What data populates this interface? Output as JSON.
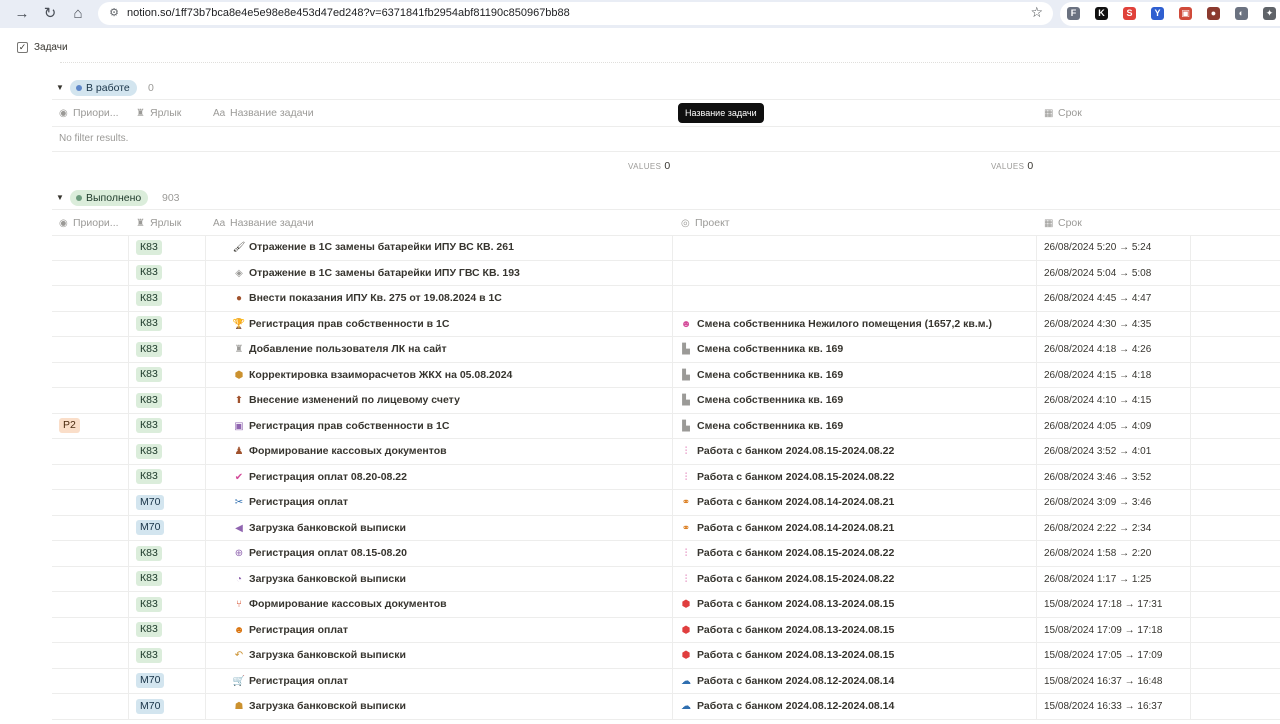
{
  "browser": {
    "url": "notion.so/1ff73b7bca8e4e5e98e8e453d47ed248?v=6371841fb2954abf81190c850967bb88",
    "extensions": [
      {
        "label": "F",
        "color": "#6b7280"
      },
      {
        "label": "K",
        "color": "#111111"
      },
      {
        "label": "S",
        "color": "#e0413a"
      },
      {
        "label": "Y",
        "color": "#2f5fd0"
      },
      {
        "label": "▣",
        "color": "#d04a3a"
      },
      {
        "label": "●",
        "color": "#8b3a2f"
      },
      {
        "label": "◐",
        "color": "#6b7280"
      },
      {
        "label": "✦",
        "color": "#5f6368"
      }
    ]
  },
  "database": {
    "title": "Задачи"
  },
  "groups": {
    "in_progress": {
      "label": "В работе",
      "count": "0",
      "no_results": "No filter results.",
      "calc_label": "VALUES",
      "calc_value": "0"
    },
    "done": {
      "label": "Выполнено",
      "count": "903"
    }
  },
  "columns": {
    "priority": "Приори...",
    "tag": "Ярлык",
    "name": "Название задачи",
    "project": "Проект",
    "date": "Срок"
  },
  "tooltip": "Название задачи",
  "rows": [
    {
      "priority": "",
      "tag": "К83",
      "tag_color": "green",
      "icon": "🖌",
      "icon_color": "#37352f",
      "name": "Отражение в 1С замены батарейки ИПУ ВС КВ. 261",
      "project_icon": "",
      "project_icon_color": "",
      "project": "",
      "date": "26/08/2024 5:20 → 5:24"
    },
    {
      "priority": "",
      "tag": "К83",
      "tag_color": "green",
      "icon": "◈",
      "icon_color": "#9b9a97",
      "name": "Отражение в 1С замены батарейки ИПУ ГВС КВ. 193",
      "project_icon": "",
      "project_icon_color": "",
      "project": "",
      "date": "26/08/2024 5:04 → 5:08"
    },
    {
      "priority": "",
      "tag": "К83",
      "tag_color": "green",
      "icon": "●",
      "icon_color": "#a0522d",
      "name": "Внести показания ИПУ Кв. 275 от 19.08.2024 в 1С",
      "project_icon": "",
      "project_icon_color": "",
      "project": "",
      "date": "26/08/2024 4:45 → 4:47"
    },
    {
      "priority": "",
      "tag": "К83",
      "tag_color": "green",
      "icon": "🏆",
      "icon_color": "#cb912f",
      "name": "Регистрация прав собственности в 1С",
      "project_icon": "☻",
      "project_icon_color": "#d44c9a",
      "project": "Смена собственника Нежилого помещения (1657,2 кв.м.)",
      "date": "26/08/2024 4:30 → 4:35"
    },
    {
      "priority": "",
      "tag": "К83",
      "tag_color": "green",
      "icon": "♜",
      "icon_color": "#9b9a97",
      "name": "Добавление пользователя ЛК на сайт",
      "project_icon": "▙",
      "project_icon_color": "#9b9a97",
      "project": "Смена собственника кв. 169",
      "date": "26/08/2024 4:18 → 4:26"
    },
    {
      "priority": "",
      "tag": "К83",
      "tag_color": "green",
      "icon": "⬢",
      "icon_color": "#cb912f",
      "name": "Корректировка взаиморасчетов ЖКХ на 05.08.2024",
      "project_icon": "▙",
      "project_icon_color": "#9b9a97",
      "project": "Смена собственника кв. 169",
      "date": "26/08/2024 4:15 → 4:18"
    },
    {
      "priority": "",
      "tag": "К83",
      "tag_color": "green",
      "icon": "⬆",
      "icon_color": "#a0522d",
      "name": "Внесение изменений по лицевому счету",
      "project_icon": "▙",
      "project_icon_color": "#9b9a97",
      "project": "Смена собственника кв. 169",
      "date": "26/08/2024 4:10 → 4:15"
    },
    {
      "priority": "P2",
      "tag": "К83",
      "tag_color": "green",
      "icon": "▣",
      "icon_color": "#9065b0",
      "name": "Регистрация прав собственности в 1С",
      "project_icon": "▙",
      "project_icon_color": "#9b9a97",
      "project": "Смена собственника кв. 169",
      "date": "26/08/2024 4:05 → 4:09"
    },
    {
      "priority": "",
      "tag": "К83",
      "tag_color": "green",
      "icon": "♟",
      "icon_color": "#a0522d",
      "name": "Формирование кассовых документов",
      "project_icon": "⫶",
      "project_icon_color": "#d44c9a",
      "project": "Работа с банком 2024.08.15-2024.08.22",
      "date": "26/08/2024 3:52 → 4:01"
    },
    {
      "priority": "",
      "tag": "К83",
      "tag_color": "green",
      "icon": "✔",
      "icon_color": "#d44c9a",
      "name": "Регистрация оплат 08.20-08.22",
      "project_icon": "⫶",
      "project_icon_color": "#d44c9a",
      "project": "Работа с банком 2024.08.15-2024.08.22",
      "date": "26/08/2024 3:46 → 3:52"
    },
    {
      "priority": "",
      "tag": "М70",
      "tag_color": "blue",
      "icon": "✂",
      "icon_color": "#2f6fb0",
      "name": "Регистрация оплат",
      "project_icon": "⚭",
      "project_icon_color": "#d9730d",
      "project": "Работа с банком 2024.08.14-2024.08.21",
      "date": "26/08/2024 3:09 → 3:46"
    },
    {
      "priority": "",
      "tag": "М70",
      "tag_color": "blue",
      "icon": "◀",
      "icon_color": "#9065b0",
      "name": "Загрузка банковской выписки",
      "project_icon": "⚭",
      "project_icon_color": "#d9730d",
      "project": "Работа с банком 2024.08.14-2024.08.21",
      "date": "26/08/2024 2:22 → 2:34"
    },
    {
      "priority": "",
      "tag": "К83",
      "tag_color": "green",
      "icon": "⊕",
      "icon_color": "#9065b0",
      "name": "Регистрация оплат 08.15-08.20",
      "project_icon": "⫶",
      "project_icon_color": "#d44c9a",
      "project": "Работа с банком 2024.08.15-2024.08.22",
      "date": "26/08/2024 1:58 → 2:20"
    },
    {
      "priority": "",
      "tag": "К83",
      "tag_color": "green",
      "icon": "◔",
      "icon_color": "#9065b0",
      "name": "Загрузка банковской выписки",
      "project_icon": "⫶",
      "project_icon_color": "#d44c9a",
      "project": "Работа с банком 2024.08.15-2024.08.22",
      "date": "26/08/2024 1:17 → 1:25"
    },
    {
      "priority": "",
      "tag": "К83",
      "tag_color": "green",
      "icon": "⑂",
      "icon_color": "#d44c2a",
      "name": "Формирование кассовых документов",
      "project_icon": "⬢",
      "project_icon_color": "#e03e3e",
      "project": "Работа с банком 2024.08.13-2024.08.15",
      "date": "15/08/2024 17:18 → 17:31"
    },
    {
      "priority": "",
      "tag": "К83",
      "tag_color": "green",
      "icon": "☻",
      "icon_color": "#d9730d",
      "name": "Регистрация оплат",
      "project_icon": "⬢",
      "project_icon_color": "#e03e3e",
      "project": "Работа с банком 2024.08.13-2024.08.15",
      "date": "15/08/2024 17:09 → 17:18"
    },
    {
      "priority": "",
      "tag": "К83",
      "tag_color": "green",
      "icon": "↶",
      "icon_color": "#cb912f",
      "name": "Загрузка банковской выписки",
      "project_icon": "⬢",
      "project_icon_color": "#e03e3e",
      "project": "Работа с банком 2024.08.13-2024.08.15",
      "date": "15/08/2024 17:05 → 17:09"
    },
    {
      "priority": "",
      "tag": "М70",
      "tag_color": "blue",
      "icon": "🛒",
      "icon_color": "#9065b0",
      "name": "Регистрация оплат",
      "project_icon": "☁",
      "project_icon_color": "#2f6fb0",
      "project": "Работа с банком 2024.08.12-2024.08.14",
      "date": "15/08/2024 16:37 → 16:48"
    },
    {
      "priority": "",
      "tag": "М70",
      "tag_color": "blue",
      "icon": "☗",
      "icon_color": "#cb912f",
      "name": "Загрузка банковской выписки",
      "project_icon": "☁",
      "project_icon_color": "#2f6fb0",
      "project": "Работа с банком 2024.08.12-2024.08.14",
      "date": "15/08/2024 16:33 → 16:37"
    }
  ]
}
